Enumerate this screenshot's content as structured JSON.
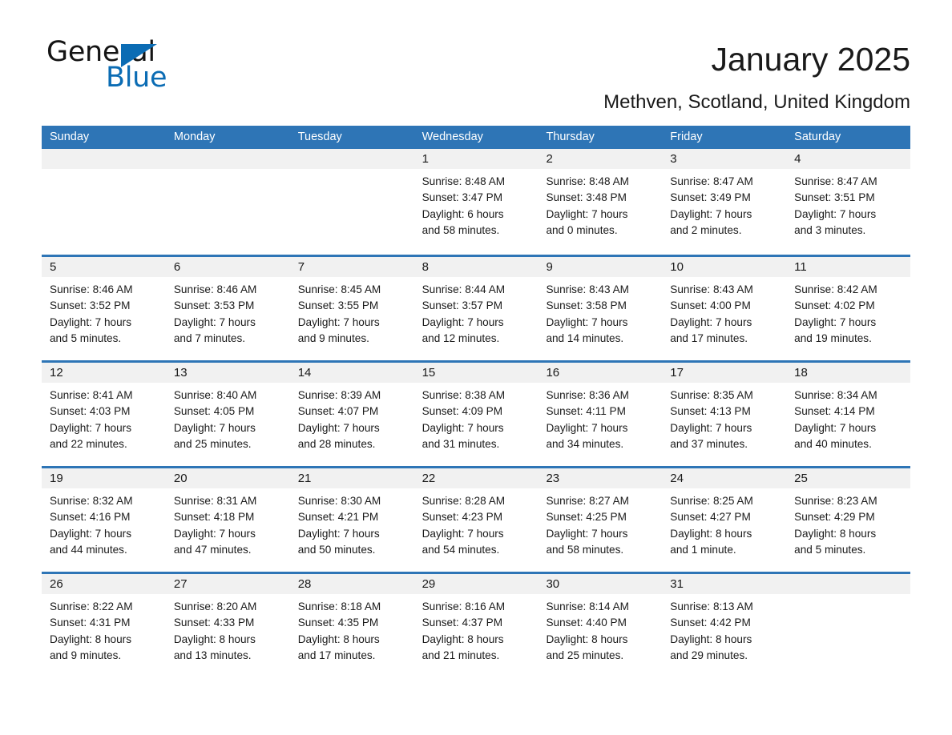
{
  "brand": {
    "name_part1": "General",
    "name_part2": "Blue",
    "triangle_color": "#0b6cb4",
    "accent_color": "#2e75b6"
  },
  "header": {
    "title": "January 2025",
    "subtitle": "Methven, Scotland, United Kingdom"
  },
  "calendar": {
    "weekdays": [
      "Sunday",
      "Monday",
      "Tuesday",
      "Wednesday",
      "Thursday",
      "Friday",
      "Saturday"
    ],
    "header_bg": "#2e75b6",
    "header_text_color": "#ffffff",
    "day_band_bg": "#f1f1f1",
    "weeks": [
      [
        {
          "day": "",
          "lines": []
        },
        {
          "day": "",
          "lines": []
        },
        {
          "day": "",
          "lines": []
        },
        {
          "day": "1",
          "lines": [
            "Sunrise: 8:48 AM",
            "Sunset: 3:47 PM",
            "Daylight: 6 hours",
            "and 58 minutes."
          ]
        },
        {
          "day": "2",
          "lines": [
            "Sunrise: 8:48 AM",
            "Sunset: 3:48 PM",
            "Daylight: 7 hours",
            "and 0 minutes."
          ]
        },
        {
          "day": "3",
          "lines": [
            "Sunrise: 8:47 AM",
            "Sunset: 3:49 PM",
            "Daylight: 7 hours",
            "and 2 minutes."
          ]
        },
        {
          "day": "4",
          "lines": [
            "Sunrise: 8:47 AM",
            "Sunset: 3:51 PM",
            "Daylight: 7 hours",
            "and 3 minutes."
          ]
        }
      ],
      [
        {
          "day": "5",
          "lines": [
            "Sunrise: 8:46 AM",
            "Sunset: 3:52 PM",
            "Daylight: 7 hours",
            "and 5 minutes."
          ]
        },
        {
          "day": "6",
          "lines": [
            "Sunrise: 8:46 AM",
            "Sunset: 3:53 PM",
            "Daylight: 7 hours",
            "and 7 minutes."
          ]
        },
        {
          "day": "7",
          "lines": [
            "Sunrise: 8:45 AM",
            "Sunset: 3:55 PM",
            "Daylight: 7 hours",
            "and 9 minutes."
          ]
        },
        {
          "day": "8",
          "lines": [
            "Sunrise: 8:44 AM",
            "Sunset: 3:57 PM",
            "Daylight: 7 hours",
            "and 12 minutes."
          ]
        },
        {
          "day": "9",
          "lines": [
            "Sunrise: 8:43 AM",
            "Sunset: 3:58 PM",
            "Daylight: 7 hours",
            "and 14 minutes."
          ]
        },
        {
          "day": "10",
          "lines": [
            "Sunrise: 8:43 AM",
            "Sunset: 4:00 PM",
            "Daylight: 7 hours",
            "and 17 minutes."
          ]
        },
        {
          "day": "11",
          "lines": [
            "Sunrise: 8:42 AM",
            "Sunset: 4:02 PM",
            "Daylight: 7 hours",
            "and 19 minutes."
          ]
        }
      ],
      [
        {
          "day": "12",
          "lines": [
            "Sunrise: 8:41 AM",
            "Sunset: 4:03 PM",
            "Daylight: 7 hours",
            "and 22 minutes."
          ]
        },
        {
          "day": "13",
          "lines": [
            "Sunrise: 8:40 AM",
            "Sunset: 4:05 PM",
            "Daylight: 7 hours",
            "and 25 minutes."
          ]
        },
        {
          "day": "14",
          "lines": [
            "Sunrise: 8:39 AM",
            "Sunset: 4:07 PM",
            "Daylight: 7 hours",
            "and 28 minutes."
          ]
        },
        {
          "day": "15",
          "lines": [
            "Sunrise: 8:38 AM",
            "Sunset: 4:09 PM",
            "Daylight: 7 hours",
            "and 31 minutes."
          ]
        },
        {
          "day": "16",
          "lines": [
            "Sunrise: 8:36 AM",
            "Sunset: 4:11 PM",
            "Daylight: 7 hours",
            "and 34 minutes."
          ]
        },
        {
          "day": "17",
          "lines": [
            "Sunrise: 8:35 AM",
            "Sunset: 4:13 PM",
            "Daylight: 7 hours",
            "and 37 minutes."
          ]
        },
        {
          "day": "18",
          "lines": [
            "Sunrise: 8:34 AM",
            "Sunset: 4:14 PM",
            "Daylight: 7 hours",
            "and 40 minutes."
          ]
        }
      ],
      [
        {
          "day": "19",
          "lines": [
            "Sunrise: 8:32 AM",
            "Sunset: 4:16 PM",
            "Daylight: 7 hours",
            "and 44 minutes."
          ]
        },
        {
          "day": "20",
          "lines": [
            "Sunrise: 8:31 AM",
            "Sunset: 4:18 PM",
            "Daylight: 7 hours",
            "and 47 minutes."
          ]
        },
        {
          "day": "21",
          "lines": [
            "Sunrise: 8:30 AM",
            "Sunset: 4:21 PM",
            "Daylight: 7 hours",
            "and 50 minutes."
          ]
        },
        {
          "day": "22",
          "lines": [
            "Sunrise: 8:28 AM",
            "Sunset: 4:23 PM",
            "Daylight: 7 hours",
            "and 54 minutes."
          ]
        },
        {
          "day": "23",
          "lines": [
            "Sunrise: 8:27 AM",
            "Sunset: 4:25 PM",
            "Daylight: 7 hours",
            "and 58 minutes."
          ]
        },
        {
          "day": "24",
          "lines": [
            "Sunrise: 8:25 AM",
            "Sunset: 4:27 PM",
            "Daylight: 8 hours",
            "and 1 minute."
          ]
        },
        {
          "day": "25",
          "lines": [
            "Sunrise: 8:23 AM",
            "Sunset: 4:29 PM",
            "Daylight: 8 hours",
            "and 5 minutes."
          ]
        }
      ],
      [
        {
          "day": "26",
          "lines": [
            "Sunrise: 8:22 AM",
            "Sunset: 4:31 PM",
            "Daylight: 8 hours",
            "and 9 minutes."
          ]
        },
        {
          "day": "27",
          "lines": [
            "Sunrise: 8:20 AM",
            "Sunset: 4:33 PM",
            "Daylight: 8 hours",
            "and 13 minutes."
          ]
        },
        {
          "day": "28",
          "lines": [
            "Sunrise: 8:18 AM",
            "Sunset: 4:35 PM",
            "Daylight: 8 hours",
            "and 17 minutes."
          ]
        },
        {
          "day": "29",
          "lines": [
            "Sunrise: 8:16 AM",
            "Sunset: 4:37 PM",
            "Daylight: 8 hours",
            "and 21 minutes."
          ]
        },
        {
          "day": "30",
          "lines": [
            "Sunrise: 8:14 AM",
            "Sunset: 4:40 PM",
            "Daylight: 8 hours",
            "and 25 minutes."
          ]
        },
        {
          "day": "31",
          "lines": [
            "Sunrise: 8:13 AM",
            "Sunset: 4:42 PM",
            "Daylight: 8 hours",
            "and 29 minutes."
          ]
        },
        {
          "day": "",
          "lines": []
        }
      ]
    ]
  }
}
